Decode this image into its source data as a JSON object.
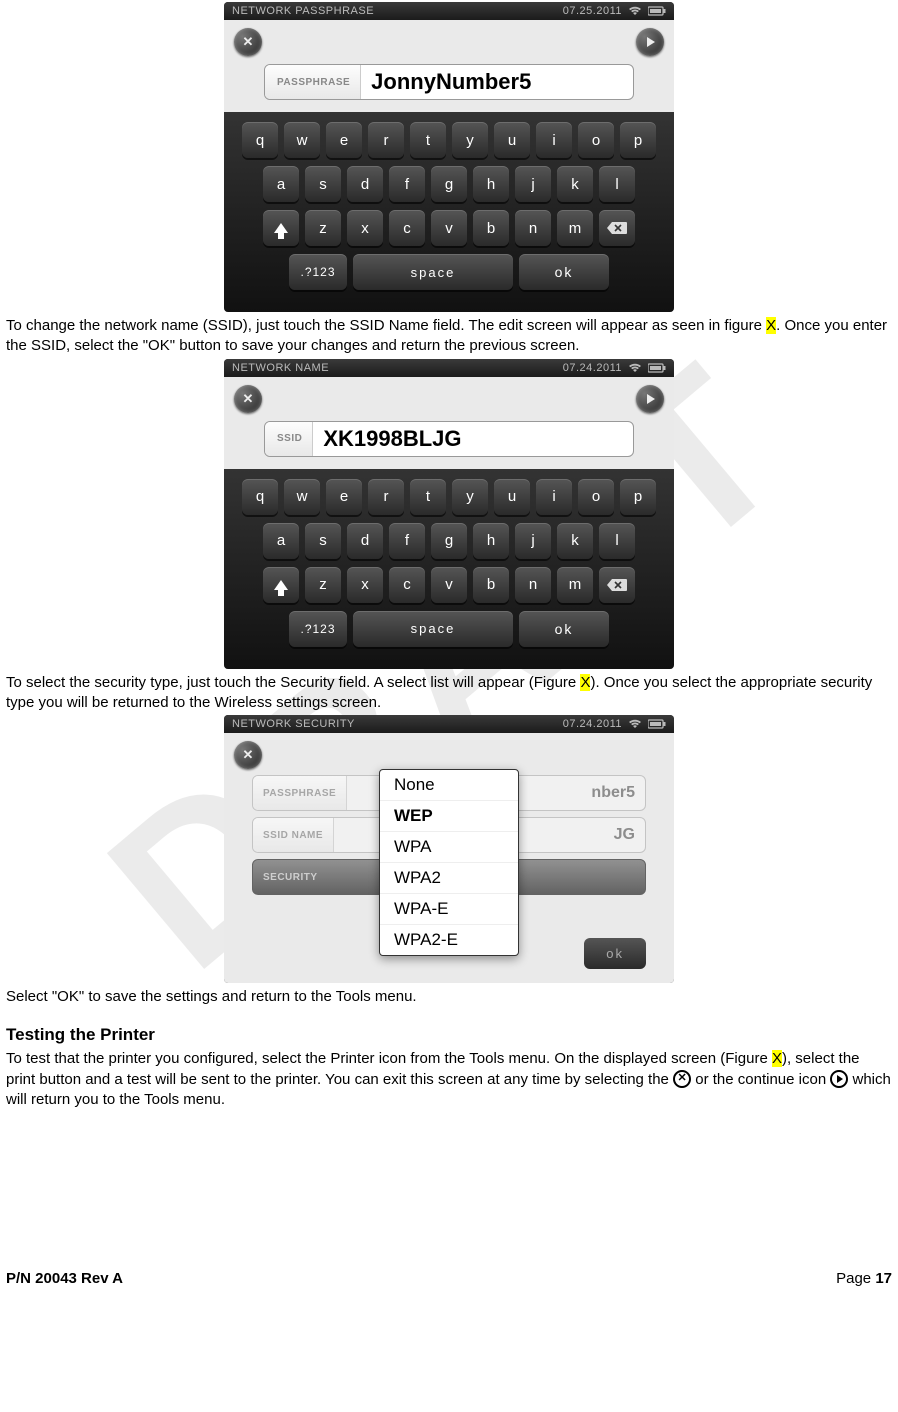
{
  "watermark": "DRAFT",
  "screen1": {
    "title": "NETWORK PASSPHRASE",
    "date": "07.25.2011",
    "field_label": "PASSPHRASE",
    "field_value": "JonnyNumber5",
    "rows": {
      "r1": [
        "q",
        "w",
        "e",
        "r",
        "t",
        "y",
        "u",
        "i",
        "o",
        "p"
      ],
      "r2": [
        "a",
        "s",
        "d",
        "f",
        "g",
        "h",
        "j",
        "k",
        "l"
      ],
      "r3": [
        "z",
        "x",
        "c",
        "v",
        "b",
        "n",
        "m"
      ]
    },
    "numkey": ".?123",
    "space": "space",
    "ok": "ok"
  },
  "para1": {
    "t1": "To change the network name (SSID), just touch the SSID Name field.  The edit screen will appear as seen in figure ",
    "x": "X",
    "t2": ".  Once you enter the SSID, select the \"OK\" button to save your changes and return the previous screen."
  },
  "screen2": {
    "title": "NETWORK NAME",
    "date": "07.24.2011",
    "field_label": "SSID",
    "field_value": "XK1998BLJG",
    "rows": {
      "r1": [
        "q",
        "w",
        "e",
        "r",
        "t",
        "y",
        "u",
        "i",
        "o",
        "p"
      ],
      "r2": [
        "a",
        "s",
        "d",
        "f",
        "g",
        "h",
        "j",
        "k",
        "l"
      ],
      "r3": [
        "z",
        "x",
        "c",
        "v",
        "b",
        "n",
        "m"
      ]
    },
    "numkey": ".?123",
    "space": "space",
    "ok": "ok"
  },
  "para2": {
    "t1": "To select the security type, just touch the Security field.  A select list will appear (Figure ",
    "x": "X",
    "t2": ").  Once you select the appropriate security type you will be returned to the Wireless settings screen."
  },
  "screen3": {
    "title": "NETWORK SECURITY",
    "date": "07.24.2011",
    "rows": {
      "passphrase_label": "PASSPHRASE",
      "passphrase_value": "nber5",
      "ssid_label": "SSID NAME",
      "ssid_value": "JG",
      "security_label": "SECURITY"
    },
    "options": [
      "None",
      "WEP",
      "WPA",
      "WPA2",
      "WPA-E",
      "WPA2-E"
    ],
    "selected": "WEP",
    "ok": "ok"
  },
  "para3": "Select \"OK\" to save the settings and return to the Tools menu.",
  "heading_test": "Testing the Printer",
  "para4": {
    "t1": "To test that the printer you configured, select the Printer icon from the Tools menu.  On the displayed screen (Figure ",
    "x": "X",
    "t2": "), select the print button and a test will be sent to the printer.  You can exit this screen at any time by selecting the ",
    "t3": " or the continue icon ",
    "t4": " which will return you to the Tools menu."
  },
  "footer": {
    "left": "P/N 20043 Rev A",
    "right_label": "Page ",
    "page": "17"
  }
}
